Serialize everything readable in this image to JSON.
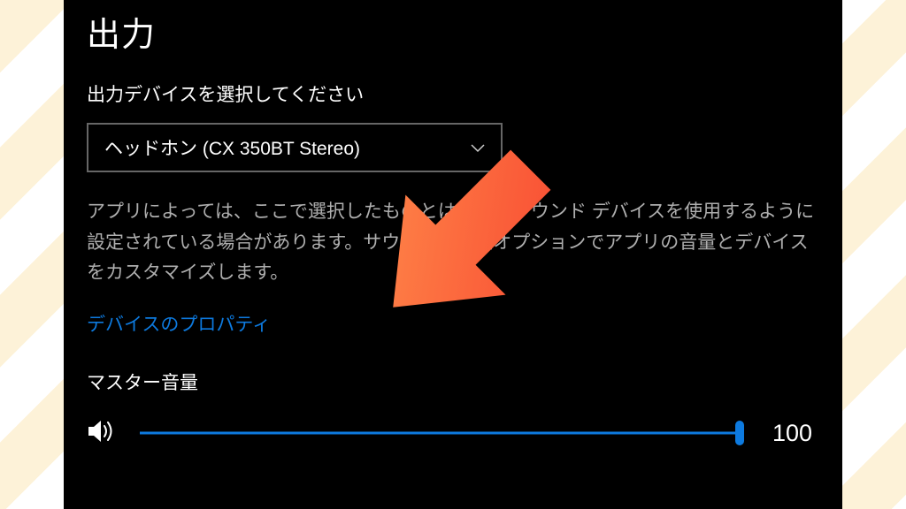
{
  "section": {
    "title": "出力",
    "device_label": "出力デバイスを選択してください",
    "device_selected": "ヘッドホン (CX 350BT Stereo)",
    "description": "アプリによっては、ここで選択したものとは異なるサウンド デバイスを使用するように設定されている場合があります。サウンドの詳細オプションでアプリの音量とデバイスをカスタマイズします。",
    "properties_link": "デバイスのプロパティ",
    "master_volume_label": "マスター音量",
    "volume_value": "100"
  },
  "colors": {
    "accent": "#0d7adf"
  }
}
